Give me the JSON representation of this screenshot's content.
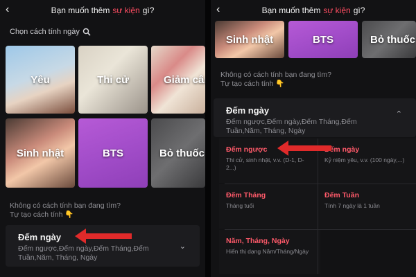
{
  "header": {
    "title_before": "Bạn muốn thêm",
    "title_highlight": "sự kiện",
    "title_after": "gì?",
    "back_icon": "chevron-left-icon"
  },
  "left": {
    "section_title": "Chọn cách tính ngày",
    "section_icon": "search-icon",
    "tiles": [
      {
        "label": "Yêu"
      },
      {
        "label": "Thi cử"
      },
      {
        "label": "Giảm cân"
      },
      {
        "label": "Sinh nhật"
      },
      {
        "label": "BTS"
      },
      {
        "label": "Bỏ thuốc"
      }
    ],
    "hint_line1": "Không có cách tính bạn đang tìm?",
    "hint_line2": "Tự tạo cách tính",
    "card": {
      "title": "Đếm ngày",
      "desc": "Đếm ngược,Đếm ngày,Đếm Tháng,Đếm Tuần,Năm, Tháng, Ngày"
    }
  },
  "right": {
    "tiles": [
      {
        "label": "Sinh nhật"
      },
      {
        "label": "BTS"
      },
      {
        "label": "Bỏ thuốc"
      }
    ],
    "hint_line1": "Không có cách tính bạn đang tìm?",
    "hint_line2": "Tự tạo cách tính",
    "card": {
      "title": "Đếm ngày",
      "desc": "Đếm ngược,Đếm ngày,Đếm Tháng,Đếm Tuần,Năm, Tháng, Ngày"
    },
    "options": [
      {
        "title": "Đếm ngược",
        "desc": "Thi cử, sinh nhật, v.v. (D-1, D-2...)"
      },
      {
        "title": "Đếm ngày",
        "desc": "Kỷ niệm yêu, v.v. (100 ngày,...)"
      },
      {
        "title": "Đếm Tháng",
        "desc": "Tháng tuổi"
      },
      {
        "title": "Đếm Tuần",
        "desc": "Tính 7 ngày là 1 tuần"
      },
      {
        "title": "Năm, Tháng, Ngày",
        "desc": "Hiển thị dạng Năm/Tháng/Ngày"
      }
    ]
  },
  "colors": {
    "accent": "#ff4d62",
    "arrow": "#e02a2a",
    "bg": "#121214"
  }
}
